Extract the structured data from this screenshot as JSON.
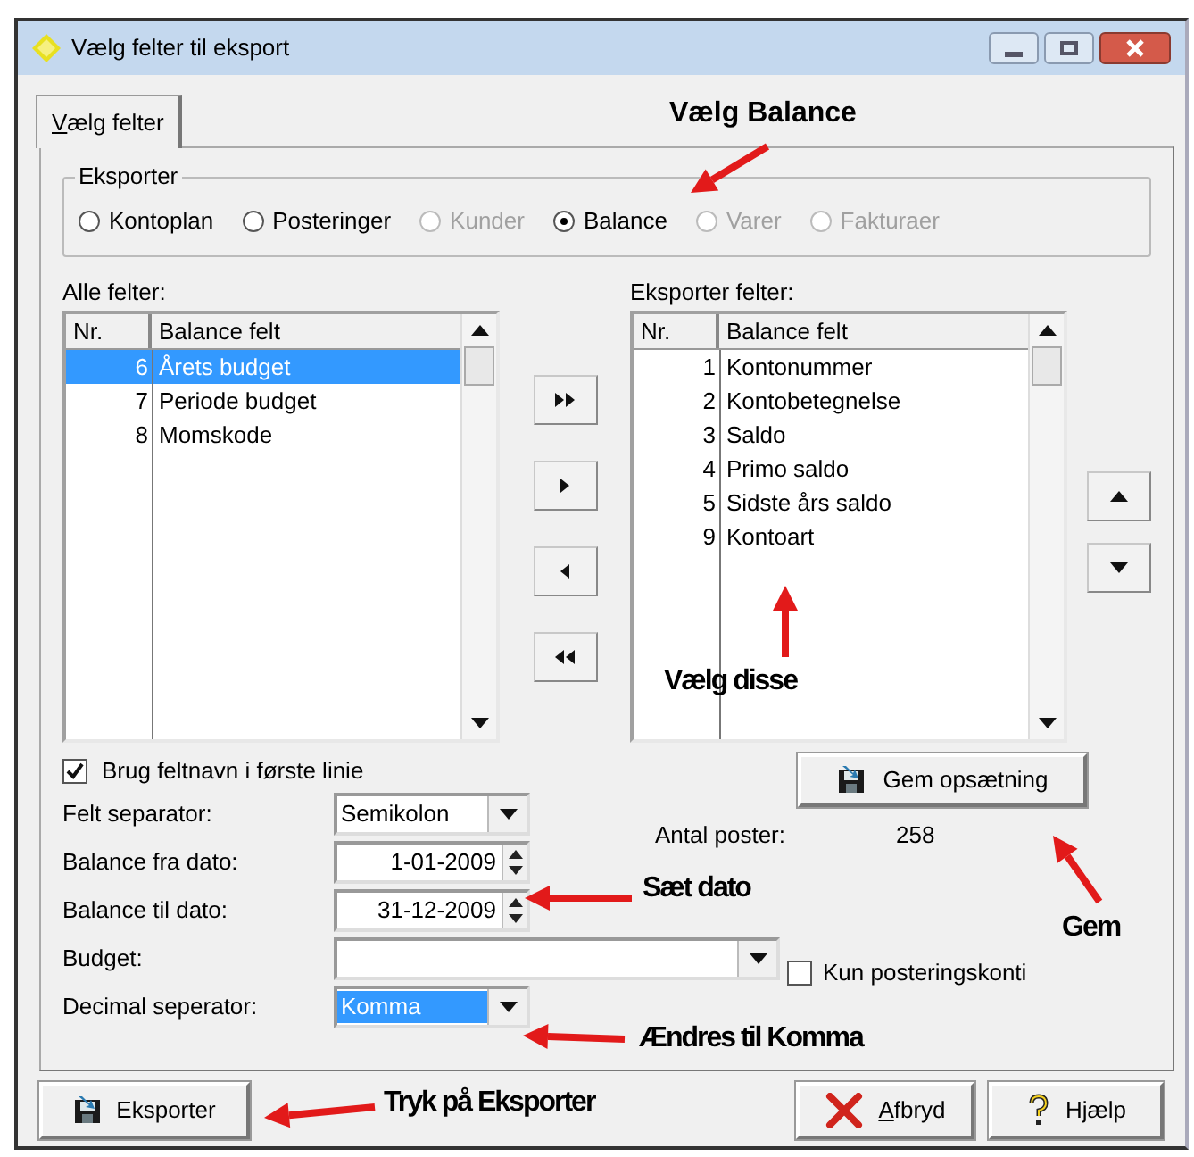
{
  "window": {
    "title": "Vælg felter til eksport"
  },
  "tabs": [
    {
      "label": "Vælg felter",
      "selected": true,
      "mnemonic": true
    }
  ],
  "export_group": {
    "label": "Eksporter",
    "options": [
      {
        "label": "Kontoplan",
        "selected": false,
        "disabled": false
      },
      {
        "label": "Posteringer",
        "selected": false,
        "disabled": false
      },
      {
        "label": "Kunder",
        "selected": false,
        "disabled": true
      },
      {
        "label": "Balance",
        "selected": true,
        "disabled": false
      },
      {
        "label": "Varer",
        "selected": false,
        "disabled": true
      },
      {
        "label": "Fakturaer",
        "selected": false,
        "disabled": true
      }
    ]
  },
  "all_fields": {
    "label": "Alle felter:",
    "columns": [
      "Nr.",
      "Balance felt"
    ],
    "rows": [
      {
        "nr": "6",
        "name": "Årets budget",
        "selected": true
      },
      {
        "nr": "7",
        "name": "Periode budget",
        "selected": false
      },
      {
        "nr": "8",
        "name": "Momskode",
        "selected": false
      }
    ]
  },
  "export_fields": {
    "label": "Eksporter felter:",
    "columns": [
      "Nr.",
      "Balance felt"
    ],
    "rows": [
      {
        "nr": "1",
        "name": "Kontonummer",
        "selected": false
      },
      {
        "nr": "2",
        "name": "Kontobetegnelse",
        "selected": false
      },
      {
        "nr": "3",
        "name": "Saldo",
        "selected": false
      },
      {
        "nr": "4",
        "name": "Primo saldo",
        "selected": false
      },
      {
        "nr": "5",
        "name": "Sidste års saldo",
        "selected": false
      },
      {
        "nr": "9",
        "name": "Kontoart",
        "selected": false
      }
    ]
  },
  "use_header": {
    "label": "Brug feltnavn i første linie",
    "checked": true
  },
  "save_setup_button": "Gem opsætning",
  "record_count": {
    "label": "Antal poster:",
    "value": "258"
  },
  "fields": [
    {
      "kind": "combo",
      "label": "Felt separator:",
      "value": "Semikolon",
      "selected": false
    },
    {
      "kind": "date",
      "label": "Balance fra dato:",
      "value": "1-01-2009"
    },
    {
      "kind": "date",
      "label": "Balance til dato:",
      "value": "31-12-2009"
    },
    {
      "kind": "combo_wide",
      "label": "Budget:"
    },
    {
      "kind": "combo",
      "label": "Decimal seperator:",
      "value": "Komma",
      "selected": true
    }
  ],
  "only_posting_accounts": {
    "label": "Kun posteringskonti",
    "checked": false
  },
  "buttons": [
    {
      "kind": "export",
      "label": "Eksporter",
      "mnemonic": false
    },
    {
      "kind": "cancel",
      "label": "Afbryd",
      "mnemonic": true
    },
    {
      "kind": "help",
      "label": "Hjælp",
      "mnemonic": false
    }
  ],
  "annotations": [
    "Vælg Balance",
    "Vælg disse",
    "Sæt dato",
    "Gem",
    "Ændres til Komma",
    "Tryk på Eksporter"
  ]
}
